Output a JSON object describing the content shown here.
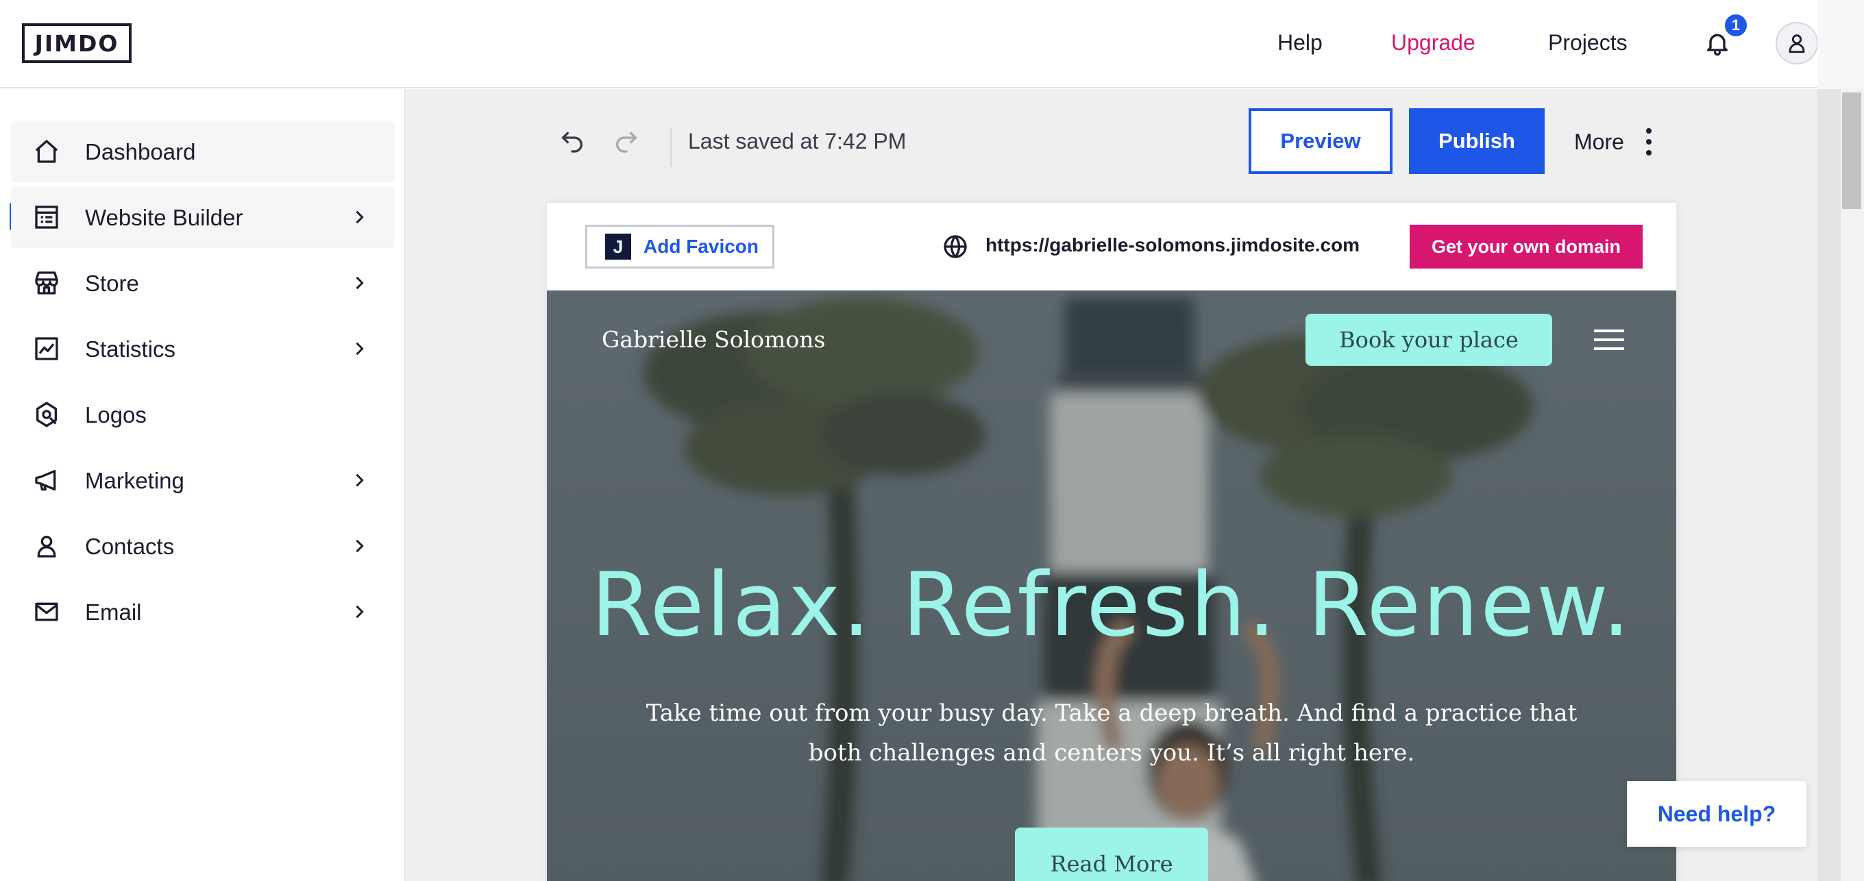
{
  "topbar": {
    "logo_text": "JIMDO",
    "help_label": "Help",
    "upgrade_label": "Upgrade",
    "projects_label": "Projects",
    "notification_count": "1",
    "notification_icon": "bell-icon",
    "account_icon": "user-icon"
  },
  "sidebar": {
    "items": [
      {
        "label": "Dashboard",
        "icon": "home-icon",
        "has_submenu": false
      },
      {
        "label": "Website Builder",
        "icon": "layout-icon",
        "has_submenu": true,
        "active": true
      },
      {
        "label": "Store",
        "icon": "store-icon",
        "has_submenu": true
      },
      {
        "label": "Statistics",
        "icon": "chart-icon",
        "has_submenu": true
      },
      {
        "label": "Logos",
        "icon": "logo-design-icon",
        "has_submenu": false
      },
      {
        "label": "Marketing",
        "icon": "megaphone-icon",
        "has_submenu": true
      },
      {
        "label": "Contacts",
        "icon": "person-icon",
        "has_submenu": true
      },
      {
        "label": "Email",
        "icon": "mail-icon",
        "has_submenu": true
      }
    ]
  },
  "toolbar": {
    "saved_text": "Last saved at 7:42 PM",
    "preview_label": "Preview",
    "publish_label": "Publish",
    "more_label": "More"
  },
  "site_bar": {
    "favicon_label": "Add Favicon",
    "favicon_letter": "J",
    "url": "https://gabrielle-solomons.jimdosite.com",
    "domain_label": "Get your own domain"
  },
  "hero": {
    "brand": "Gabrielle Solomons",
    "book_label": "Book your place",
    "headline": "Relax. Refresh. Renew.",
    "subtext": "Take time out from your busy day. Take a deep breath. And find a practice that both challenges and centers you. It’s all right here.",
    "read_more_label": "Read More"
  },
  "help_widget": {
    "label": "Need help?"
  },
  "colors": {
    "accent_blue": "#1e57e8",
    "accent_pink": "#d6166f",
    "hero_mint": "#9cf3e8",
    "dark_text": "#1c1c2e"
  }
}
